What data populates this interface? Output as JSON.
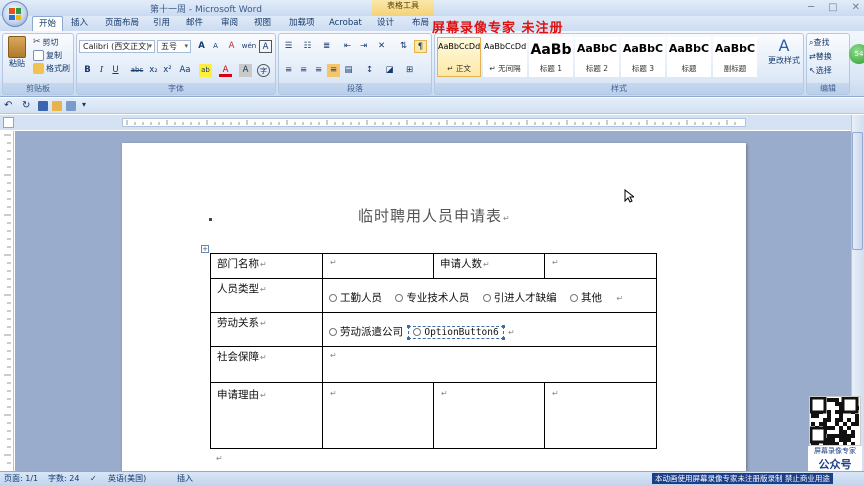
{
  "window": {
    "doc_title": "第十一周 - Microsoft Word",
    "context_tab": "表格工具",
    "controls": [
      "─",
      "□",
      "✕"
    ]
  },
  "watermark": {
    "top": "屏幕录像专家  未注册",
    "bottom": "本动画使用屏幕录像专家未注册版录制 禁止商业用途",
    "qr_caption": "屏幕录像专家",
    "qr_caption2": "公众号"
  },
  "tabs": [
    "开始",
    "插入",
    "页面布局",
    "引用",
    "邮件",
    "审阅",
    "视图",
    "加载项",
    "Acrobat",
    "设计",
    "布局"
  ],
  "ribbon": {
    "clipboard": {
      "paste": "粘贴",
      "cut": "剪切",
      "copy": "复制",
      "format_painter": "格式刷",
      "label": "剪贴板"
    },
    "font": {
      "family": "Calibri (西文正文)",
      "size": "五号",
      "label": "字体",
      "bold": "B",
      "italic": "I",
      "underline": "U",
      "strike": "abc",
      "sub": "x₂",
      "sup": "x²",
      "case": "Aa",
      "grow": "A",
      "shrink": "A",
      "clear": "A",
      "wen": "wén",
      "border_a": "A",
      "highlight": "ab",
      "color": "A",
      "shade_a": "A",
      "circle": "字"
    },
    "paragraph": {
      "label": "段落"
    },
    "styles": {
      "label": "样式",
      "items": [
        {
          "sample": "AaBbCcDd",
          "name": "↵ 正文"
        },
        {
          "sample": "AaBbCcDd",
          "name": "↵ 无间隔"
        },
        {
          "sample": "AaBb",
          "name": "标题 1"
        },
        {
          "sample": "AaBbC",
          "name": "标题 2"
        },
        {
          "sample": "AaBbC",
          "name": "标题 3"
        },
        {
          "sample": "AaBbC",
          "name": "标题"
        },
        {
          "sample": "AaBbC",
          "name": "副标题"
        }
      ],
      "change": "更改样式"
    },
    "editing": {
      "find": "查找",
      "replace": "替换",
      "select": "选择",
      "label": "编辑"
    }
  },
  "document": {
    "heading": "临时聘用人员申请表",
    "table": {
      "dept_label": "部门名称",
      "count_label": "申请人数",
      "type_label": "人员类型",
      "type_options": [
        "工勤人员",
        "专业技术人员",
        "引进人才缺编",
        "其他"
      ],
      "relation_label": "劳动关系",
      "relation_option1": "劳动派遣公司",
      "relation_option2": "OptionButton6",
      "security_label": "社会保障",
      "reason_label": "申请理由"
    },
    "para_mark": "↵"
  },
  "status": {
    "page": "页面: 1/1",
    "words": "字数: 24",
    "language": "英语(美国)",
    "mode": "插入"
  },
  "badge": "54"
}
